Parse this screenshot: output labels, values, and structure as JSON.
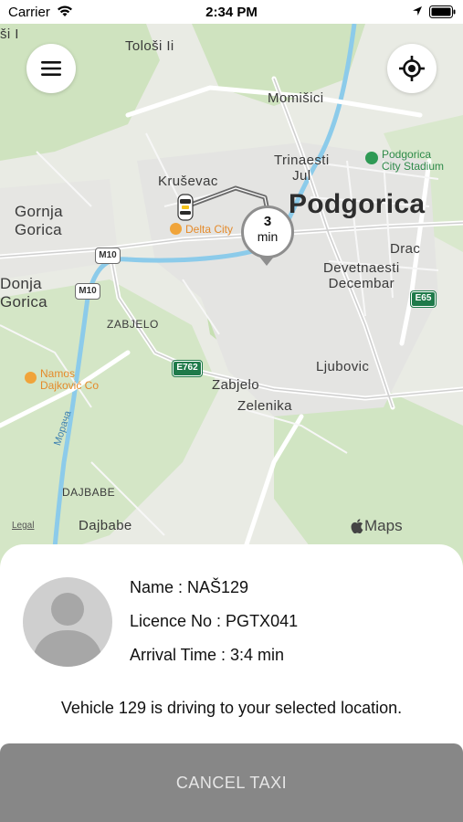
{
  "status_bar": {
    "carrier": "Carrier",
    "time": "2:34 PM"
  },
  "map": {
    "attribution": "Legal",
    "brand": "Maps",
    "labels": {
      "toplabel": "ši I",
      "tolosi": "Tološi Ii",
      "momisici": "Momišici",
      "trinaesti_jul": "Trinaesti\nJul",
      "krusevac": "Kruševac",
      "podgorica": "Podgorica",
      "podgorica_stadium": "Podgorica\nCity Stadium",
      "gornja_gorica": "Gornja\nGorica",
      "delta_city": "Delta City",
      "drac": "Drac",
      "devetnaesti_decembar": "Devetnaesti\nDecembar",
      "donja_gorica": "Donja\nGorica",
      "zabjelo_caps": "ZABJELO",
      "ljubovic": "Ljubovic",
      "namos": "Namos\nDajković Co",
      "zabjelo": "Zabjelo",
      "zelenika": "Zelenika",
      "moraca": "Морача",
      "dajbabe_caps": "DAJBABE",
      "dajbabe": "Dajbabe"
    },
    "shields": {
      "m10_a": "M10",
      "m10_b": "M10",
      "e762": "E762",
      "e65": "E65"
    },
    "eta": {
      "value": "3",
      "unit": "min"
    },
    "colors": {
      "water": "#8ccbea",
      "park": "#c6e0b4",
      "route": "#5a5a5a"
    }
  },
  "driver": {
    "name_line": "Name : NAŠ129",
    "licence_line": "Licence No : PGTX041",
    "arrival_line": "Arrival Time : 3:4 min"
  },
  "status_message": "Vehicle 129 is driving to your selected location.",
  "actions": {
    "cancel_label": "CANCEL TAXI"
  }
}
